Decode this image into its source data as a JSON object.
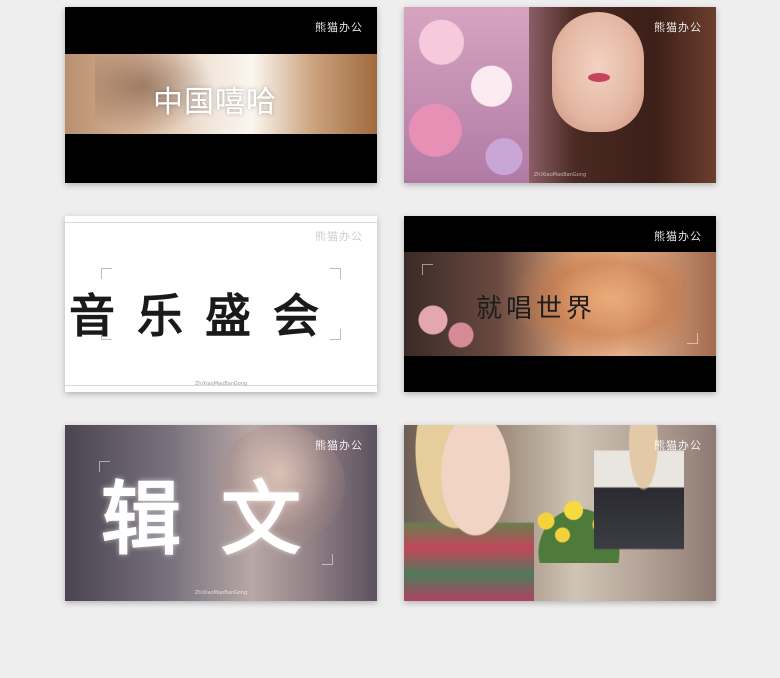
{
  "cards": [
    {
      "title": "中国嘻哈",
      "watermark": "熊猫办公"
    },
    {
      "title": "",
      "watermark": "熊猫办公",
      "footer": "ZhiXiaoMaoBanGong"
    },
    {
      "title": "音乐盛会",
      "watermark": "熊猫办公",
      "footer": "ZhiXiaoMaoBanGong"
    },
    {
      "title": "就唱世界",
      "watermark": "熊猫办公"
    },
    {
      "title": "辑文",
      "watermark": "熊猫办公",
      "footer": "ZhiXiaoMaoBanGong"
    },
    {
      "title": "",
      "watermark": "熊猫办公"
    }
  ]
}
